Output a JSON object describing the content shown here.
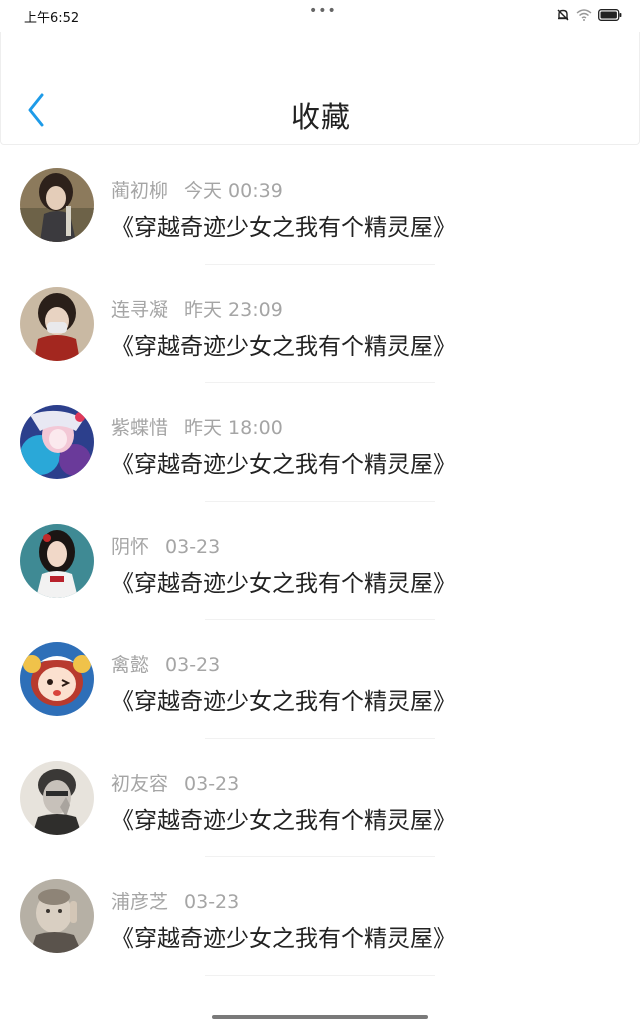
{
  "status_bar": {
    "time": "上午6:52",
    "dots": "•••",
    "icons": [
      "mute-bell-icon",
      "wifi-icon",
      "battery-icon"
    ]
  },
  "header": {
    "back_icon": "chevron-left-icon",
    "title": "收藏"
  },
  "colors": {
    "accent": "#1e9be8",
    "meta_text": "#a5a5a5",
    "title_text": "#222222"
  },
  "favorites": [
    {
      "name": "蔺初柳",
      "time": "今天 00:39",
      "book": "《穿越奇迹少女之我有个精灵屋》",
      "avatar": "avatar-photo-girl"
    },
    {
      "name": "连寻凝",
      "time": "昨天 23:09",
      "book": "《穿越奇迹少女之我有个精灵屋》",
      "avatar": "avatar-photo-masked"
    },
    {
      "name": "紫蝶惜",
      "time": "昨天 18:00",
      "book": "《穿越奇迹少女之我有个精灵屋》",
      "avatar": "avatar-anime"
    },
    {
      "name": "阴怀",
      "time": "03-23",
      "book": "《穿越奇迹少女之我有个精灵屋》",
      "avatar": "avatar-photo-woman"
    },
    {
      "name": "禽懿",
      "time": "03-23",
      "book": "《穿越奇迹少女之我有个精灵屋》",
      "avatar": "avatar-cartoon-sheep"
    },
    {
      "name": "初友容",
      "time": "03-23",
      "book": "《穿越奇迹少女之我有个精灵屋》",
      "avatar": "avatar-photo-bw"
    },
    {
      "name": "浦彦芝",
      "time": "03-23",
      "book": "《穿越奇迹少女之我有个精灵屋》",
      "avatar": "avatar-photo-kid"
    }
  ]
}
